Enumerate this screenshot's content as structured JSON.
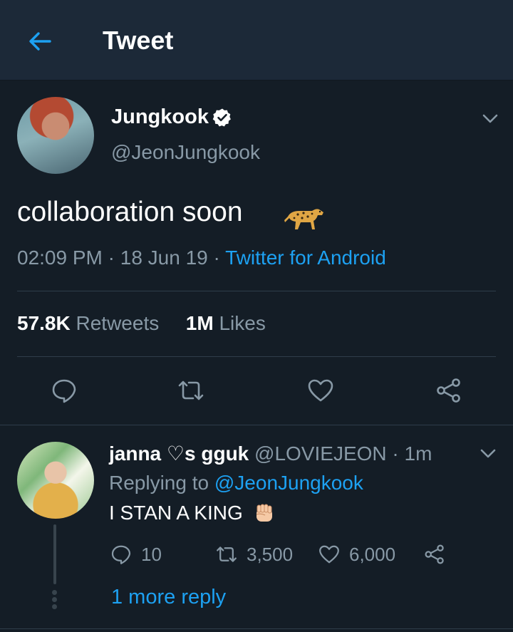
{
  "header": {
    "title": "Tweet",
    "back_icon": "arrow-left-icon"
  },
  "tweet": {
    "name": "Jungkook",
    "handle": "@JeonJungkook",
    "text": "collaboration soon",
    "emoji_icon": "cheetah-emoji-icon",
    "time": "02:09 PM",
    "date": "18 Jun 19",
    "separator": "·",
    "source": "Twitter for Android",
    "retweets_count": "57.8K",
    "retweets_label": "Retweets",
    "likes_count": "1M",
    "likes_label": "Likes"
  },
  "reply": {
    "name": "janna ♡s gguk",
    "handle": "@LOVIEJEON",
    "time": "1m",
    "replying_label": "Replying to",
    "replying_to": "@JeonJungkook",
    "text": "I STAN A KING",
    "emoji_icon": "raised-fist-emoji-icon",
    "replies": "10",
    "retweets": "3,500",
    "likes": "6,000",
    "more_replies": "1 more reply"
  },
  "colors": {
    "background": "#141d26",
    "header": "#1c2938",
    "accent": "#1da1f2",
    "muted": "#8899a6"
  }
}
